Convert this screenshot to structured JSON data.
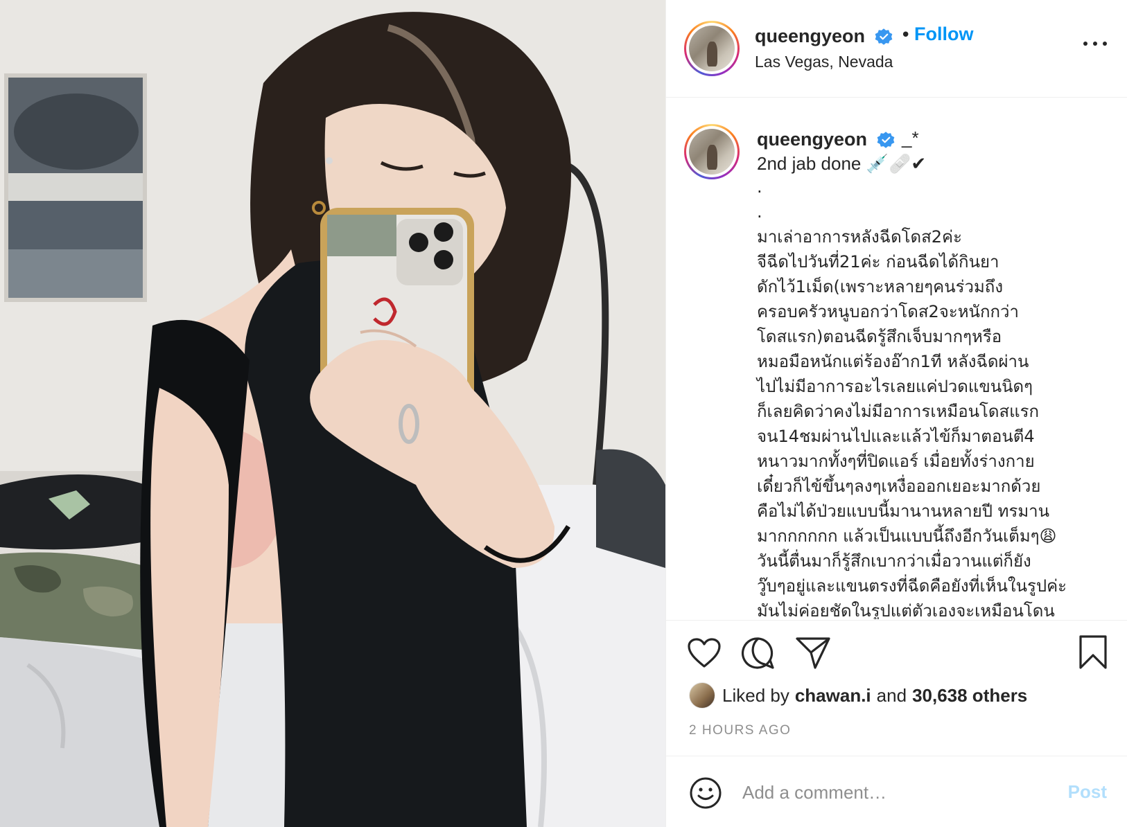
{
  "post_author": {
    "username": "queengyeon",
    "verified": true,
    "follow_label": "Follow",
    "separator": "•",
    "location": "Las Vegas, Nevada"
  },
  "caption": {
    "username": "queengyeon",
    "tag_suffix": "_*",
    "title": "2nd jab done 💉🩹✔",
    "lines": [
      ".",
      ".",
      "มาเล่าอาการหลังฉีดโดส2ค่ะ",
      "จีฉีดไปวันที่21ค่ะ ก่อนฉีดได้กินยา",
      "ดักไว้1เม็ด(เพราะหลายๆคนร่วมถึง",
      "ครอบครัวหนูบอกว่าโดส2จะหนักกว่า",
      "โดสแรก)ตอนฉีดรู้สึกเจ็บมากๆหรือ",
      "หมอมือหนักแต่ร้องอ๊าก1ที หลังฉีดผ่าน",
      "ไปไม่มีอาการอะไรเลยแค่ปวดแขนนิดๆ",
      "ก็เลยคิดว่าคงไม่มีอาการเหมือนโดสแรก",
      "จน14ชมผ่านไปและแล้วไข้ก็มาตอนตี4",
      "หนาวมากทั้งๆที่ปิดแอร์ เมื่อยทั้งร่างกาย",
      "เดี๋ยวก็ไข้ขึ้นๆลงๆเหงื่อออกเยอะมากด้วย",
      "คือไม่ได้ป่วยแบบนี้มานานหลายปี ทรมาน",
      "มากกกกกก แล้วเป็นแบบนี้ถึงอีกวันเต็มๆ😩",
      "วันนี้ตื่นมาก็รู้สึกเบากว่าเมื่อวานแต่ก็ยัง",
      "วู๊บๆอยู่และแขนตรงที่ฉีดคือยังที่เห็นในรูปค่ะ",
      "มันไม่ค่อยชัดในรูปแต่ตัวเองจะเหมือนโดน"
    ]
  },
  "icons": {
    "like": "heart-icon",
    "comment": "comment-icon",
    "share": "paper-plane-icon",
    "save": "bookmark-icon",
    "more": "more-options-icon",
    "emoji": "smiley-icon",
    "verified": "verified-badge-icon"
  },
  "likes": {
    "prefix": "Liked by",
    "user": "chawan.i",
    "conjunction": "and",
    "count_text": "30,638 others"
  },
  "timestamp": "2 HOURS AGO",
  "comment": {
    "placeholder": "Add a comment…",
    "post_label": "Post"
  },
  "colors": {
    "link_blue": "#0095f6",
    "post_disabled": "#b2dffc",
    "verified_blue": "#3897f0",
    "muted": "#8e8e8e"
  }
}
